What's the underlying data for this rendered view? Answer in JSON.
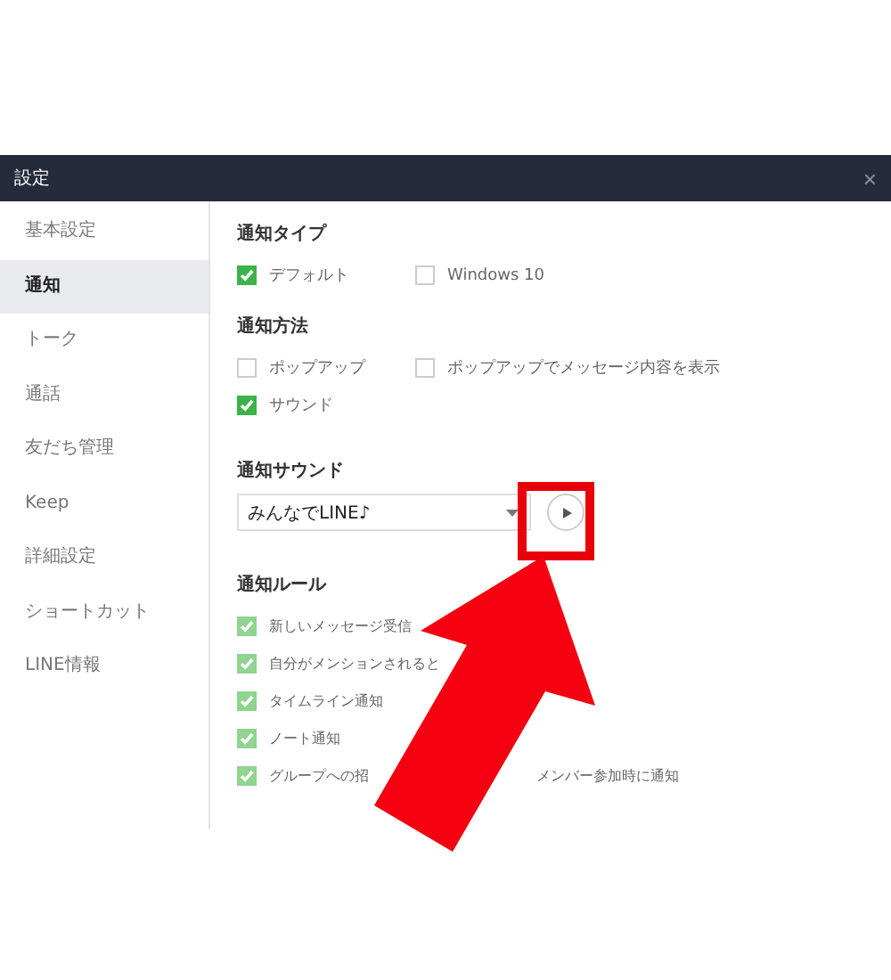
{
  "window": {
    "title": "設定",
    "close": "×"
  },
  "sidebar": {
    "items": [
      {
        "label": "基本設定",
        "selected": false
      },
      {
        "label": "通知",
        "selected": true
      },
      {
        "label": "トーク",
        "selected": false
      },
      {
        "label": "通話",
        "selected": false
      },
      {
        "label": "友だち管理",
        "selected": false
      },
      {
        "label": "Keep",
        "selected": false
      },
      {
        "label": "詳細設定",
        "selected": false
      },
      {
        "label": "ショートカット",
        "selected": false
      },
      {
        "label": "LINE情報",
        "selected": false
      }
    ]
  },
  "sections": [
    {
      "kind": "options",
      "title": "通知タイプ",
      "options": [
        [
          {
            "label": "デフォルト",
            "checked": true
          },
          {
            "label": "Windows 10",
            "checked": false
          }
        ]
      ]
    },
    {
      "kind": "options",
      "title": "通知方法",
      "options": [
        [
          {
            "label": "ポップアップ",
            "checked": false
          },
          {
            "label": "ポップアップでメッセージ内容を表示",
            "checked": false
          }
        ],
        [
          {
            "label": "サウンド",
            "checked": true
          }
        ]
      ]
    },
    {
      "kind": "sound",
      "title": "通知サウンド",
      "value": "みんなでLINE♪"
    },
    {
      "kind": "rules",
      "title": "通知ルール",
      "options": [
        [
          {
            "label": "新しいメッセージ受信",
            "checked": true
          }
        ],
        [
          {
            "label": "自分がメンションされると",
            "checked": true
          }
        ],
        [
          {
            "label": "タイムライン通知",
            "checked": true
          }
        ],
        [
          {
            "label": "ノート通知",
            "checked": true
          }
        ],
        [
          {
            "label": "グループへの招",
            "checked": true,
            "tail": "メンバー参加時に通知"
          }
        ]
      ]
    }
  ]
}
